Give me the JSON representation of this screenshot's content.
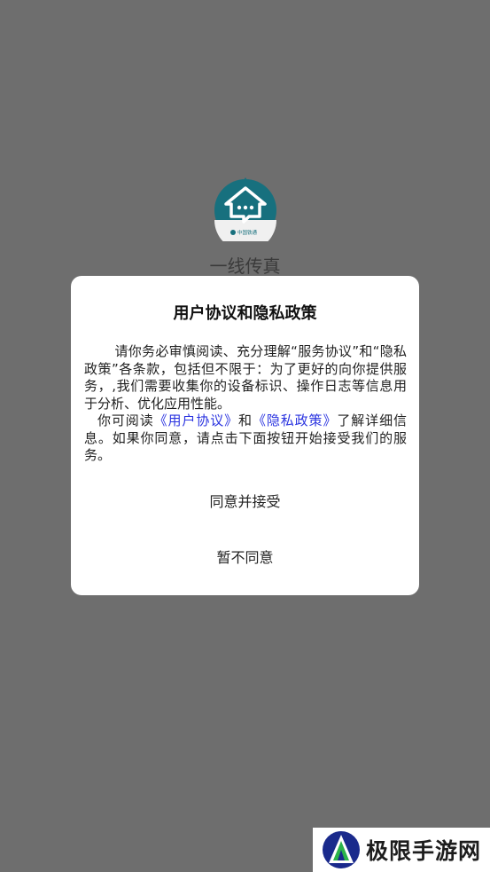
{
  "app": {
    "name": "一线传真",
    "logo_caption": "中国铁通"
  },
  "dialog": {
    "title": "用户协议和隐私政策",
    "paragraph1": "请你务必审慎阅读、充分理解“服务协议”和“隐私政策”各条款，包括但不限于：为了更好的向你提供服务，,我们需要收集你的设备标识、操作日志等信息用于分析、优化应用性能。",
    "p2_prefix": "你可阅读",
    "user_agreement_link": "《用户协议》",
    "p2_and": "和",
    "privacy_policy_link": "《隐私政策》",
    "p2_suffix": "了解详细信息。如果你同意，请点击下面按钮开始接受我们的服务。",
    "agree_button": "同意并接受",
    "disagree_button": "暂不同意"
  },
  "watermark": {
    "text": "极限手游网"
  },
  "colors": {
    "overlay": "#6e6e6e",
    "logo_teal": "#17707e",
    "link": "#2b34e0"
  }
}
